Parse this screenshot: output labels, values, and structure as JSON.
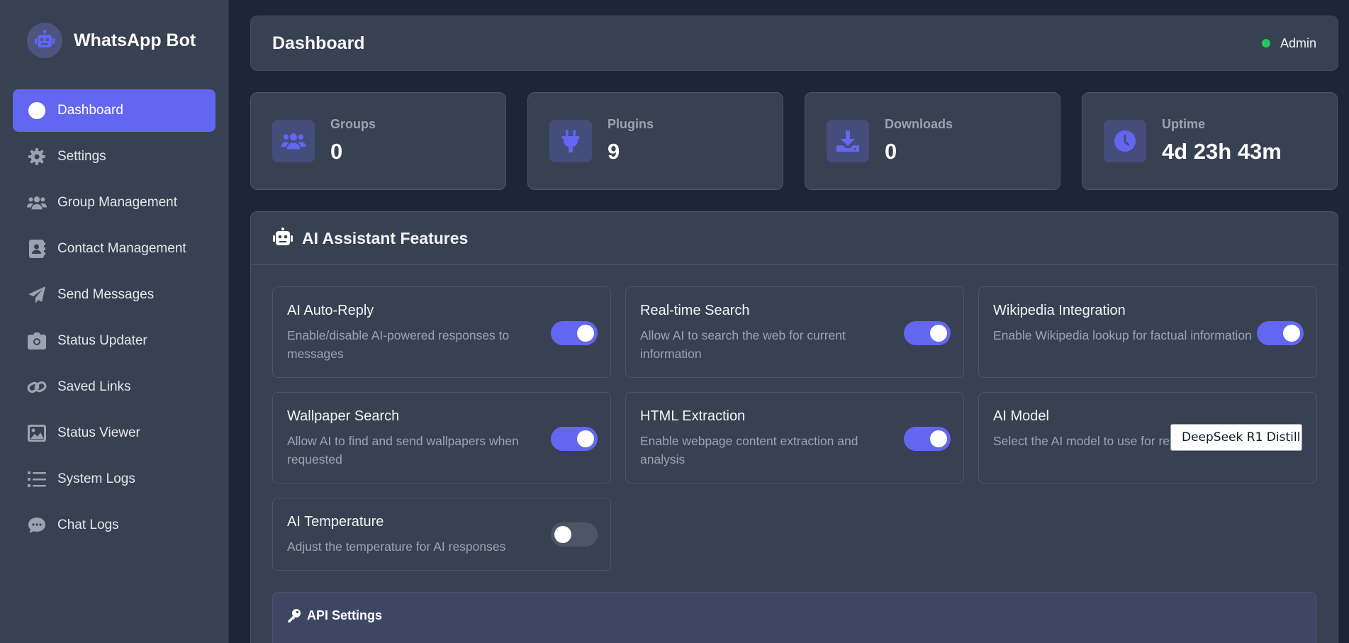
{
  "brand": {
    "title": "WhatsApp Bot"
  },
  "sidebar": {
    "items": [
      {
        "label": "Dashboard",
        "icon": "gauge-icon",
        "active": true
      },
      {
        "label": "Settings",
        "icon": "gear-icon"
      },
      {
        "label": "Group Management",
        "icon": "users-icon"
      },
      {
        "label": "Contact Management",
        "icon": "contact-book-icon"
      },
      {
        "label": "Send Messages",
        "icon": "paper-plane-icon"
      },
      {
        "label": "Status Updater",
        "icon": "camera-icon"
      },
      {
        "label": "Saved Links",
        "icon": "link-icon"
      },
      {
        "label": "Status Viewer",
        "icon": "image-icon"
      },
      {
        "label": "System Logs",
        "icon": "list-icon"
      },
      {
        "label": "Chat Logs",
        "icon": "chat-bubble-icon"
      }
    ]
  },
  "header": {
    "title": "Dashboard",
    "user": "Admin",
    "status_color": "#22c55e"
  },
  "stats": [
    {
      "label": "Groups",
      "value": "0",
      "icon": "users-icon"
    },
    {
      "label": "Plugins",
      "value": "9",
      "icon": "plug-icon"
    },
    {
      "label": "Downloads",
      "value": "0",
      "icon": "download-icon"
    },
    {
      "label": "Uptime",
      "value": "4d 23h 43m",
      "icon": "clock-icon"
    }
  ],
  "ai_panel": {
    "title": "AI Assistant Features",
    "features": [
      {
        "title": "AI Auto-Reply",
        "desc": "Enable/disable AI-powered responses to messages",
        "enabled": true
      },
      {
        "title": "Real-time Search",
        "desc": "Allow AI to search the web for current information",
        "enabled": true
      },
      {
        "title": "Wikipedia Integration",
        "desc": "Enable Wikipedia lookup for factual information",
        "enabled": true
      },
      {
        "title": "Wallpaper Search",
        "desc": "Allow AI to find and send wallpapers when requested",
        "enabled": true
      },
      {
        "title": "HTML Extraction",
        "desc": "Enable webpage content extraction and analysis",
        "enabled": true
      },
      {
        "title": "AI Model",
        "desc": "Select the AI model to use for responses",
        "selected": "DeepSeek R1 Distill"
      },
      {
        "title": "AI Temperature",
        "desc": "Adjust the temperature for AI responses",
        "enabled": false
      }
    ],
    "api_title": "API Settings"
  },
  "colors": {
    "accent": "#6366f1",
    "background": "#1e2636",
    "card": "#374151"
  }
}
